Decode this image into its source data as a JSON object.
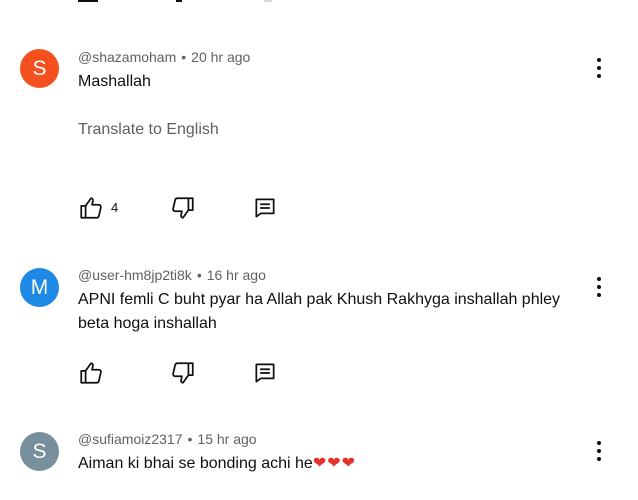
{
  "colors": {
    "avatar_s_orange": "#f4511e",
    "avatar_m_blue": "#1e88e5",
    "avatar_s_gray": "#78909c",
    "meta_text": "#606060",
    "body_text": "#0f0f0f"
  },
  "comments": [
    {
      "avatar_letter": "S",
      "handle": "@shazamoham",
      "separator": "•",
      "time": "20 hr ago",
      "text": "Mashallah",
      "translate_label": "Translate to English",
      "like_count": "4"
    },
    {
      "avatar_letter": "M",
      "handle": "@user-hm8jp2ti8k",
      "separator": "•",
      "time": "16 hr ago",
      "text": "APNI femli C buht pyar ha Allah pak Khush Rakhyga inshallah phley beta hoga inshallah"
    },
    {
      "avatar_letter": "S",
      "handle": "@sufiamoiz2317",
      "separator": "•",
      "time": "15 hr ago",
      "text": "Aiman ki bhai se bonding achi he",
      "emoji": "❤❤❤"
    }
  ],
  "icons": {
    "like": "thumb-up-icon",
    "dislike": "thumb-down-icon",
    "reply": "reply-comment-icon",
    "more": "more-vert-icon"
  }
}
